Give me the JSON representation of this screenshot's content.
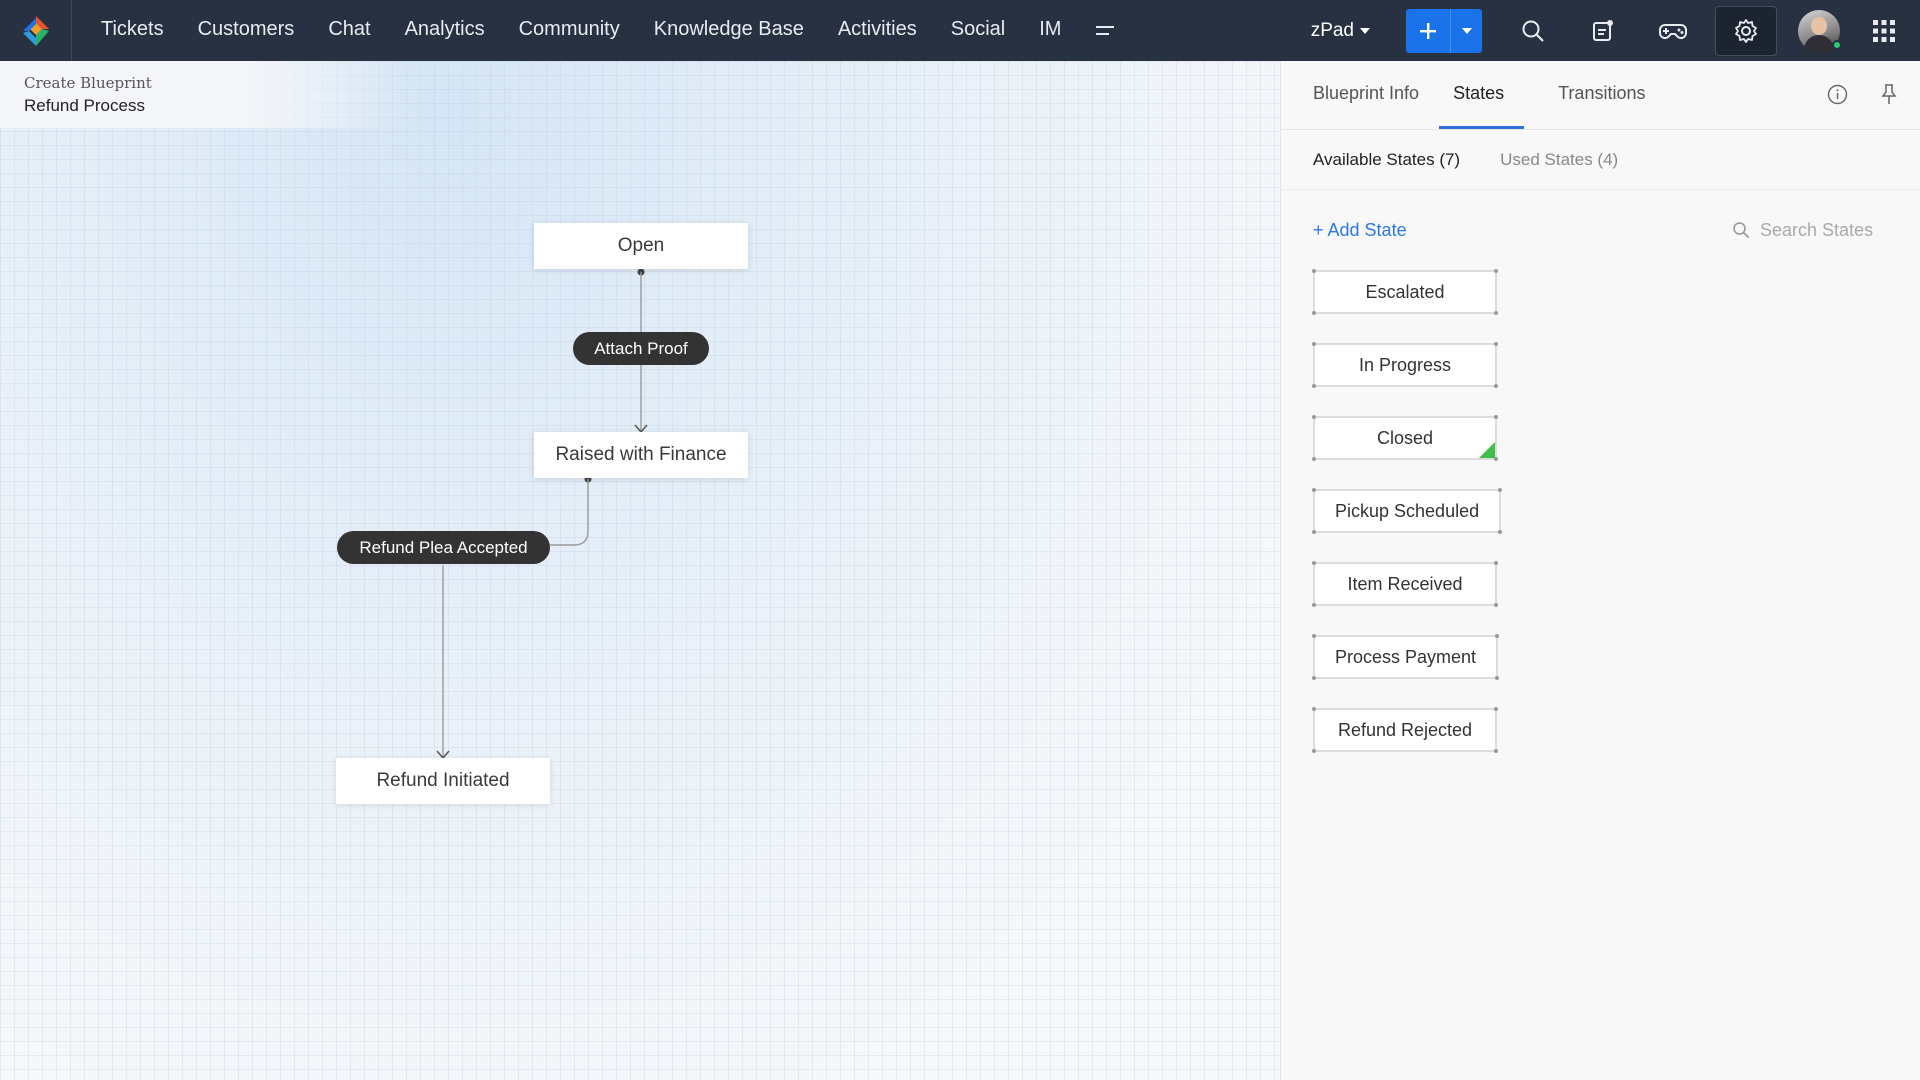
{
  "nav": {
    "items": [
      "Tickets",
      "Customers",
      "Chat",
      "Analytics",
      "Community",
      "Knowledge Base",
      "Activities",
      "Social",
      "IM"
    ],
    "department": "zPad"
  },
  "breadcrumb": {
    "parent": "Create Blueprint",
    "title": "Refund Process"
  },
  "flow": {
    "states": {
      "open": "Open",
      "raised": "Raised with Finance",
      "initiated": "Refund Initiated"
    },
    "transitions": {
      "attach_proof": "Attach Proof",
      "plea_accepted": "Refund Plea Accepted"
    }
  },
  "panel": {
    "tabs": [
      "Blueprint Info",
      "States",
      "Transitions"
    ],
    "active_tab": "States",
    "subtabs": {
      "available": "Available States (7)",
      "used": "Used States (4)"
    },
    "add_state": "+ Add State",
    "search_placeholder": "Search States",
    "states": [
      "Escalated",
      "In Progress",
      "Closed",
      "Pickup Scheduled",
      "Item Received",
      "Process Payment",
      "Refund Rejected"
    ]
  },
  "colors": {
    "topbar": "#283142",
    "accent": "#1a73e8",
    "link": "#2c78e4",
    "closed_marker": "#3fbf4a"
  }
}
